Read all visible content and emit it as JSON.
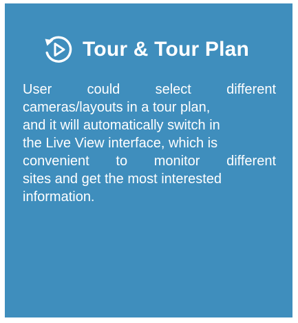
{
  "card": {
    "title": "Tour & Tour Plan",
    "icon": "replay-play-icon",
    "description_lines": [
      "User could select different",
      "cameras/layouts in a tour plan,",
      "and it will automatically switch in",
      "the Live View interface, which is",
      "convenient to monitor different",
      "sites and get the most interested",
      "information."
    ]
  },
  "colors": {
    "background": "#3f8ebd",
    "text": "#ffffff"
  }
}
